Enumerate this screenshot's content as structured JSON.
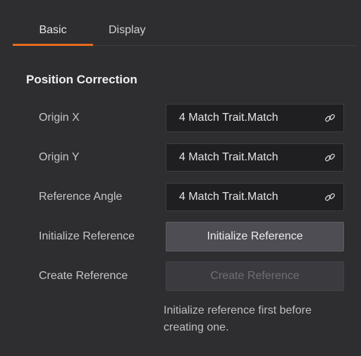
{
  "tabs": {
    "basic": "Basic",
    "display": "Display"
  },
  "section": {
    "title": "Position Correction"
  },
  "rows": {
    "origin_x": {
      "label": "Origin X",
      "value": "4 Match Trait.Match"
    },
    "origin_y": {
      "label": "Origin Y",
      "value": "4 Match Trait.Match"
    },
    "reference_angle": {
      "label": "Reference Angle",
      "value": "4 Match Trait.Match"
    },
    "initialize_reference": {
      "label": "Initialize Reference",
      "button": "Initialize Reference"
    },
    "create_reference": {
      "label": "Create Reference",
      "button": "Create Reference"
    }
  },
  "hint": {
    "line1": "Initialize reference first before",
    "line2": "creating one."
  },
  "icons": {
    "link": "link-icon"
  },
  "colors": {
    "accent": "#e66a1e",
    "background": "#2e2e31",
    "field": "#1f1f22"
  }
}
